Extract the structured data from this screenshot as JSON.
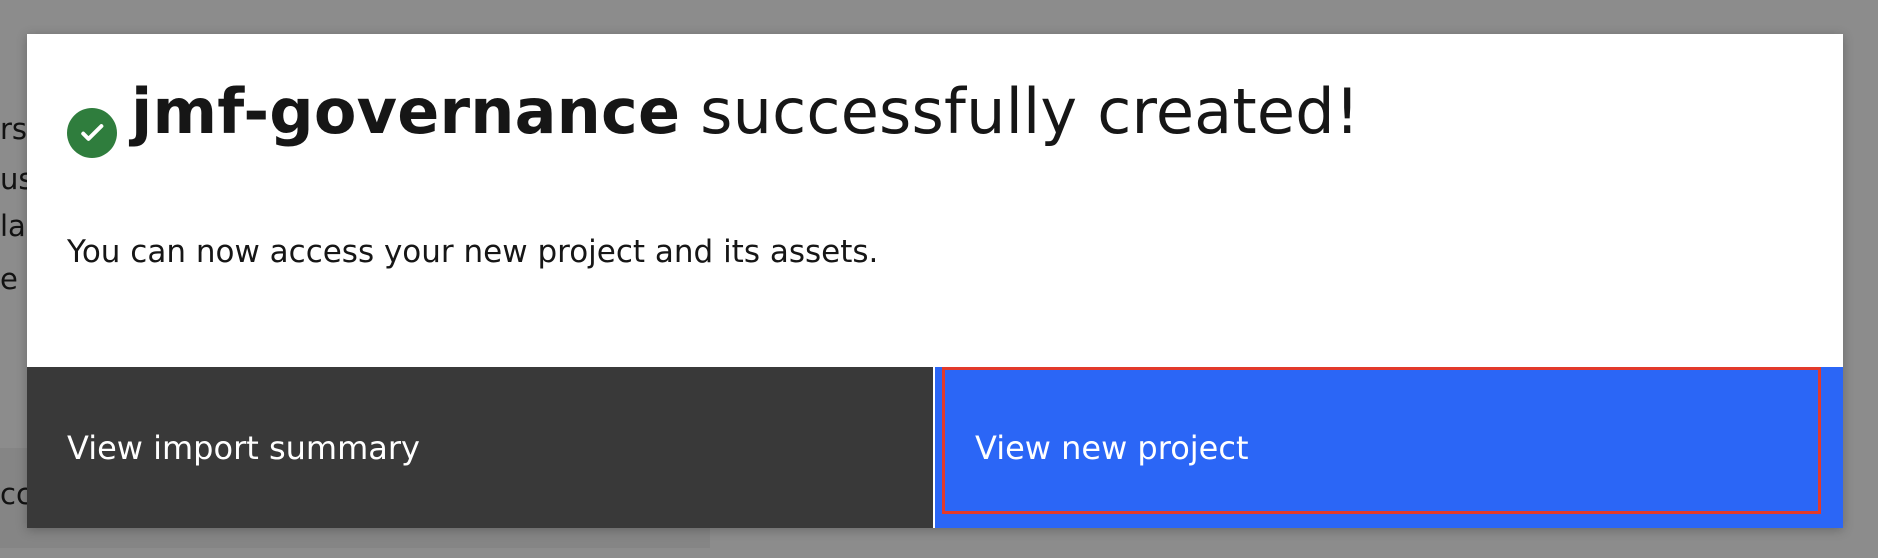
{
  "background": {
    "text_fragments": [
      "rs",
      "use",
      "la",
      "e c",
      "cc"
    ]
  },
  "modal": {
    "status": {
      "icon_name": "check-circle-icon",
      "color": "#2f7d3d"
    },
    "title": {
      "project_name": "jmf-governance",
      "suffix": " successfully created!"
    },
    "message": "You can now access your new project and its assets.",
    "buttons": {
      "secondary_label": "View import summary",
      "primary_label": "View new project",
      "secondary_color": "#393939",
      "primary_color": "#2b66f6",
      "focus_ring_color": "#e23a2b"
    }
  }
}
